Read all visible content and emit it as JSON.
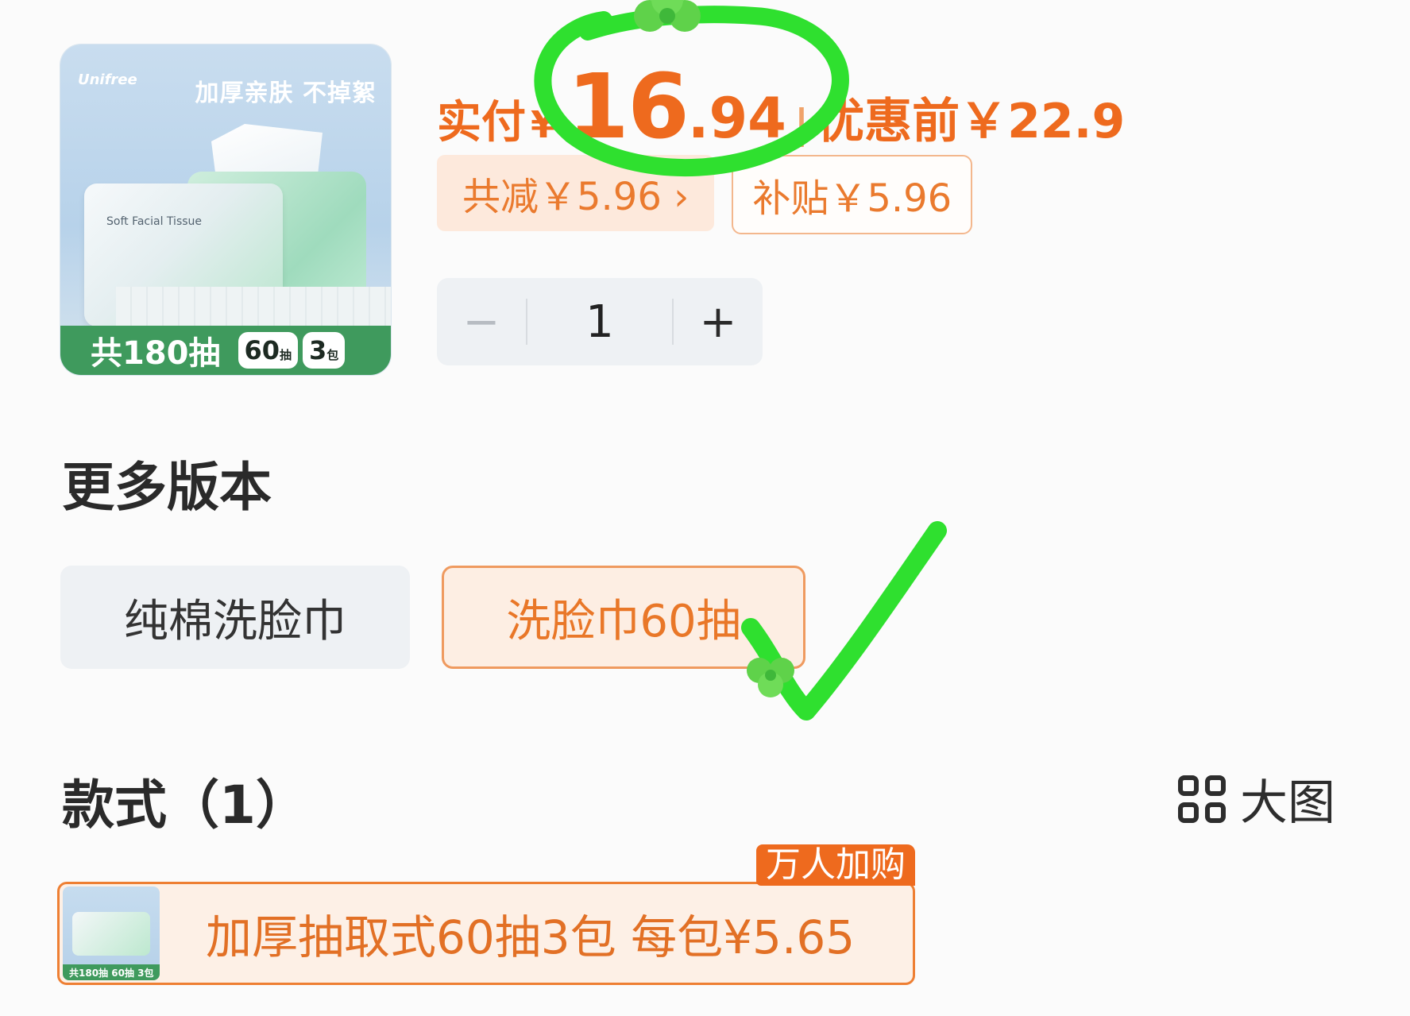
{
  "product": {
    "brand": "Unifree",
    "slogan": "加厚亲肤 不掉絮",
    "pack_label": "Soft Facial Tissue",
    "total_label": "共180抽",
    "chip_count": "60",
    "chip_count_unit": "抽",
    "chip_packs": "3",
    "chip_packs_unit": "包"
  },
  "price": {
    "label": "实付",
    "currency": "¥",
    "integer": "16",
    "decimal": ".94",
    "separator": "|",
    "original": "优惠前￥22.9"
  },
  "discounts": {
    "save_label": "共减￥5.96 ›",
    "subsidy_label": "补贴￥5.96"
  },
  "quantity": {
    "minus": "−",
    "value": "1",
    "plus": "+"
  },
  "versions": {
    "title": "更多版本",
    "options": [
      {
        "label": "纯棉洗脸巾",
        "selected": false
      },
      {
        "label": "洗脸巾60抽",
        "selected": true
      }
    ]
  },
  "styles": {
    "title": "款式（1）",
    "big_view_label": "大图",
    "big_view_icon": "grid-icon",
    "items": [
      {
        "badge": "万人加购",
        "description": "加厚抽取式60抽3包  每包¥5.65",
        "thumb_bar": "共180抽 60抽 3包"
      }
    ]
  },
  "colors": {
    "accent": "#ee6a1e",
    "annotation": "#2fe02f"
  }
}
